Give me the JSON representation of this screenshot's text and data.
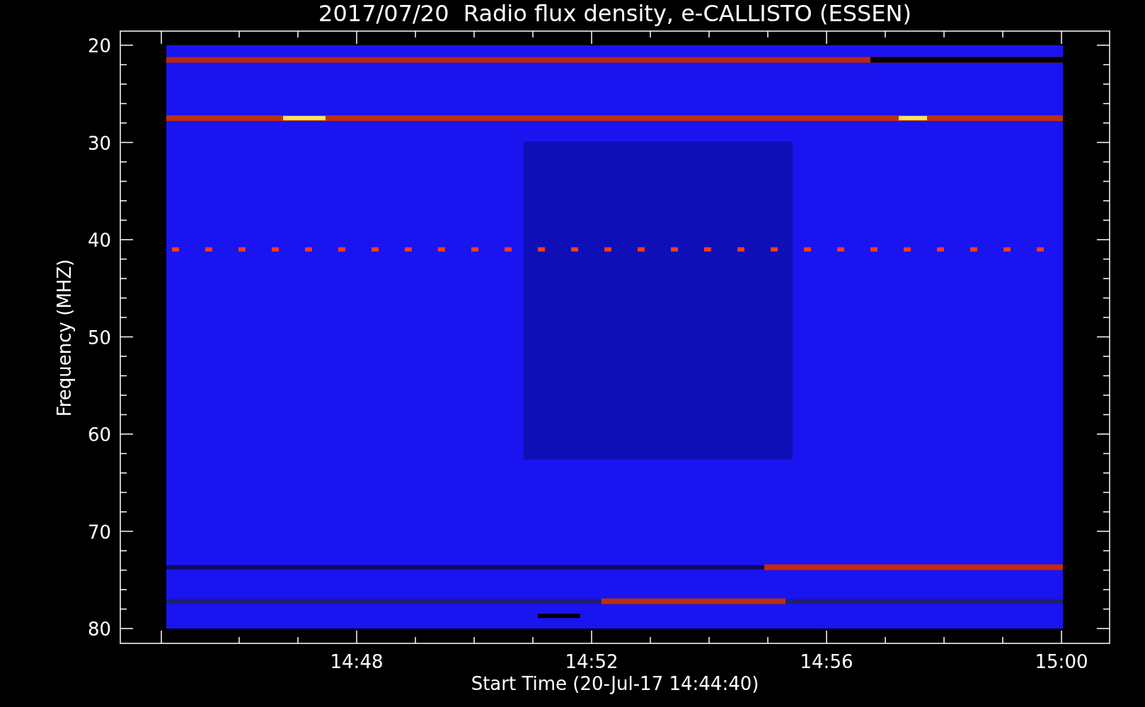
{
  "title": "2017/07/20  Radio flux density, e-CALLISTO (ESSEN)",
  "ylabel": "Frequency (MHZ)",
  "xlabel": "Start Time (20-Jul-17 14:44:40)",
  "yticks": [
    "20",
    "30",
    "40",
    "50",
    "60",
    "70",
    "80"
  ],
  "xticks": [
    "14:48",
    "14:52",
    "14:56",
    "15:00"
  ]
}
